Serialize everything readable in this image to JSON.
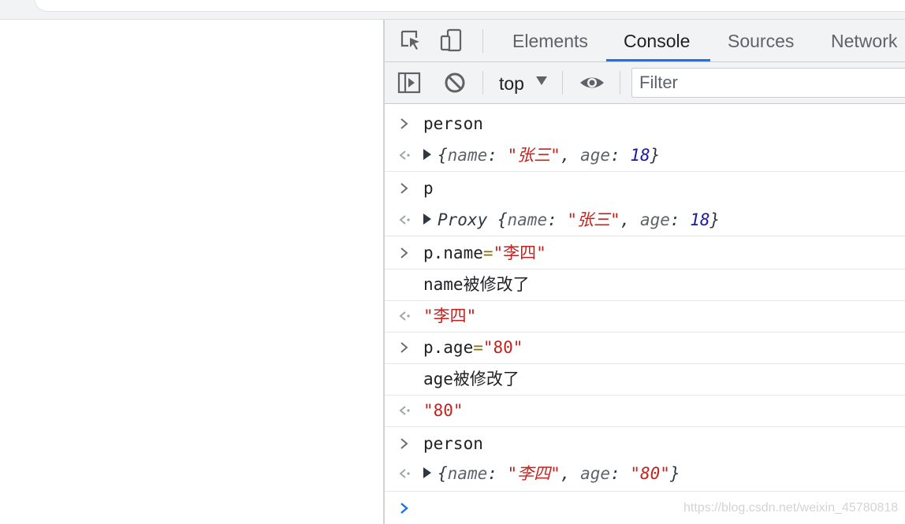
{
  "devtools": {
    "tabs": [
      {
        "label": "Elements"
      },
      {
        "label": "Console"
      },
      {
        "label": "Sources"
      },
      {
        "label": "Network"
      }
    ],
    "active_tab": "Console",
    "toolbar": {
      "context": "top",
      "filter_placeholder": "Filter"
    },
    "colors": {
      "accent": "#1a73e8",
      "string": "#c5221f",
      "number": "#1a1aa6"
    },
    "console": {
      "lines": [
        {
          "kind": "input",
          "text": "person"
        },
        {
          "kind": "result",
          "prefix": "",
          "k1": "name",
          "v1": "\"张三\"",
          "k2": "age",
          "v2": "18"
        },
        {
          "kind": "input",
          "text": "p"
        },
        {
          "kind": "result",
          "prefix": "Proxy ",
          "k1": "name",
          "v1": "\"张三\"",
          "k2": "age",
          "v2": "18"
        },
        {
          "kind": "input",
          "lhs": "p.name",
          "op": "=",
          "rhs": "\"李四\""
        },
        {
          "kind": "log",
          "text": "name被修改了"
        },
        {
          "kind": "return",
          "text": "\"李四\""
        },
        {
          "kind": "input",
          "lhs": "p.age",
          "op": "=",
          "rhs": "\"80\""
        },
        {
          "kind": "log",
          "text": "age被修改了"
        },
        {
          "kind": "return",
          "text": "\"80\""
        },
        {
          "kind": "input",
          "text": "person"
        },
        {
          "kind": "result",
          "prefix": "",
          "k1": "name",
          "v1": "\"李四\"",
          "k2": "age",
          "v2": "\"80\""
        }
      ],
      "prompt_symbol": "›"
    }
  },
  "watermark": "https://blog.csdn.net/weixin_45780818"
}
